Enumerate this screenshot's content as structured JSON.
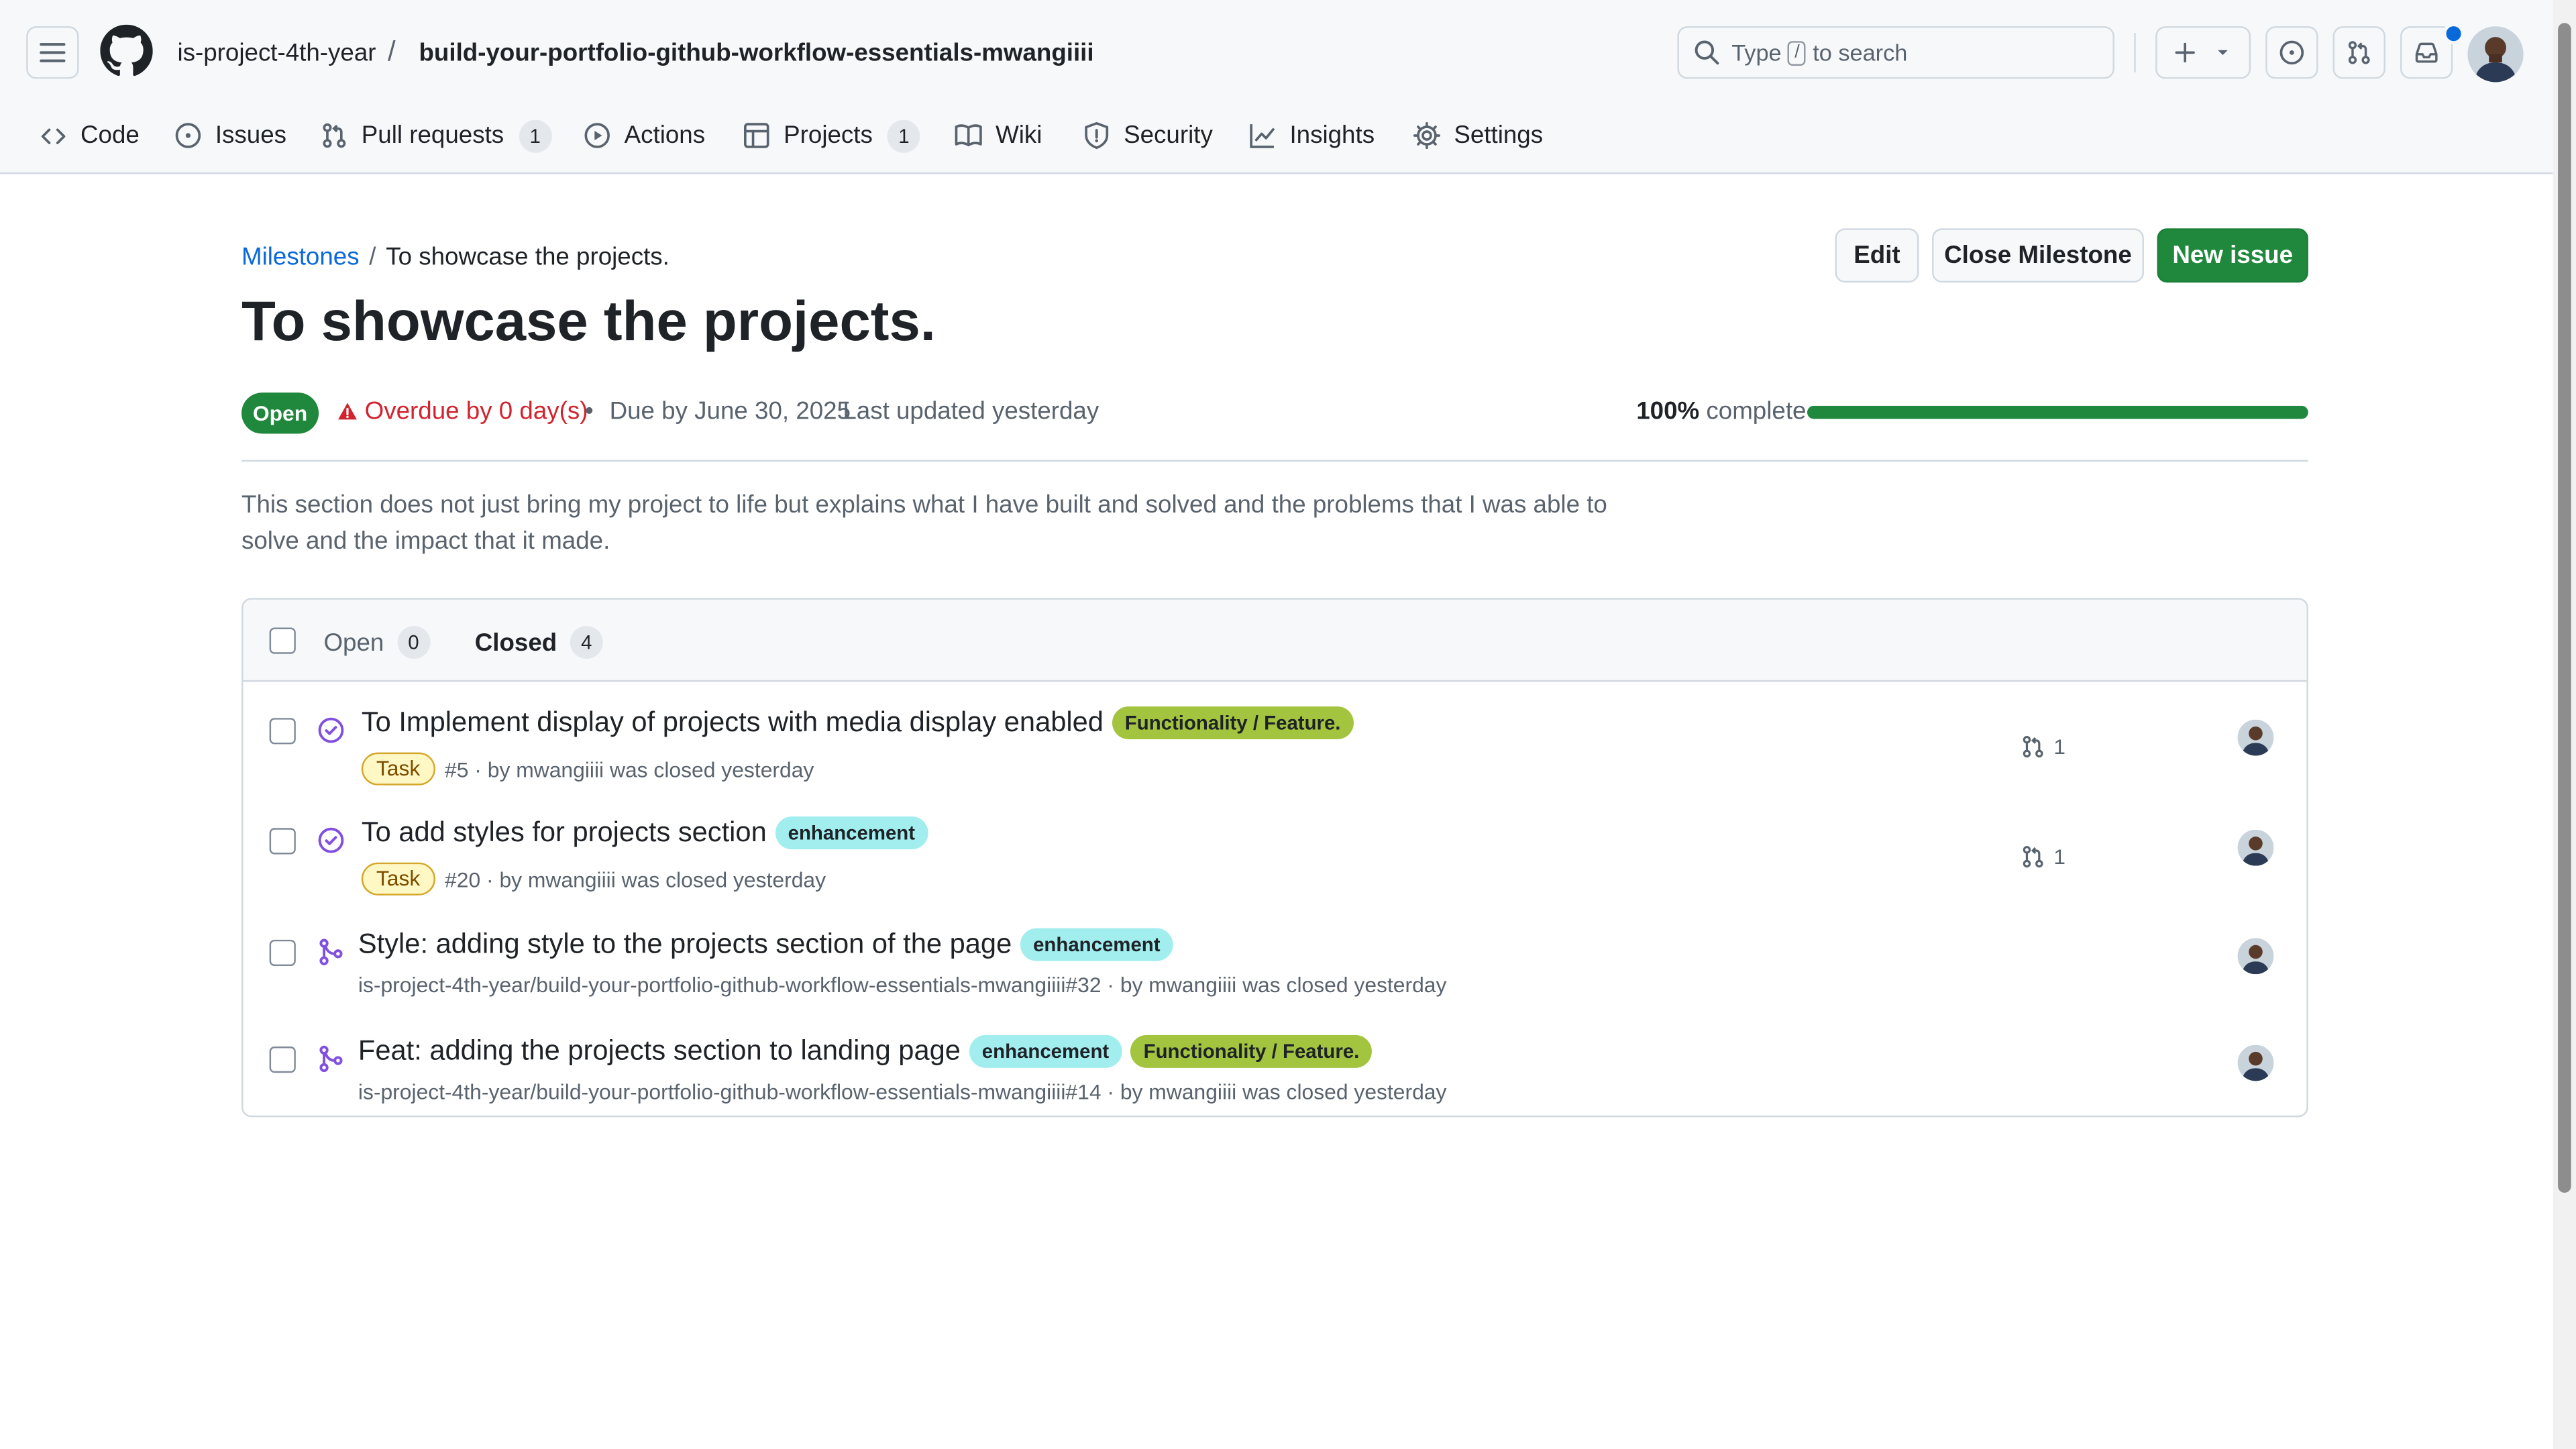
{
  "header": {
    "owner": "is-project-4th-year",
    "separator": "/",
    "repo": "build-your-portfolio-github-workflow-essentials-mwangiiii",
    "search_prefix": "Type",
    "search_key": "/",
    "search_suffix": "to search"
  },
  "tabs": [
    {
      "label": "Code",
      "icon": "code-icon"
    },
    {
      "label": "Issues",
      "icon": "issue-opened-icon"
    },
    {
      "label": "Pull requests",
      "icon": "git-pull-request-icon",
      "count": "1"
    },
    {
      "label": "Actions",
      "icon": "play-icon"
    },
    {
      "label": "Projects",
      "icon": "table-icon",
      "count": "1"
    },
    {
      "label": "Wiki",
      "icon": "book-icon"
    },
    {
      "label": "Security",
      "icon": "shield-icon"
    },
    {
      "label": "Insights",
      "icon": "graph-icon"
    },
    {
      "label": "Settings",
      "icon": "gear-icon"
    }
  ],
  "milestone": {
    "breadcrumb_link": "Milestones",
    "breadcrumb_sep": "/",
    "breadcrumb_current": "To showcase the projects.",
    "title": "To showcase the projects.",
    "state": "Open",
    "overdue": "Overdue by 0 day(s)",
    "bullet": "•",
    "due": "Due by June 30, 2025",
    "updated": "Last updated yesterday",
    "percent": "100%",
    "complete_word": "complete",
    "progress": 1.0,
    "description": "This section does not just bring my project to life but explains what I have built and solved and the problems that I was able to solve and the impact that it made."
  },
  "actions": {
    "edit": "Edit",
    "close": "Close Milestone",
    "new_issue": "New issue"
  },
  "filters": {
    "open_label": "Open",
    "open_count": "0",
    "closed_label": "Closed",
    "closed_count": "4"
  },
  "issues": [
    {
      "title": "To Implement display of projects with media display enabled",
      "labels": [
        "Functionality / Feature."
      ],
      "type": "Task",
      "meta": "#5 · by mwangiiii was closed yesterday",
      "linked_prs": "1"
    },
    {
      "title": "To add styles for projects section",
      "labels": [
        "enhancement"
      ],
      "type": "Task",
      "meta": "#20 · by mwangiiii was closed yesterday",
      "linked_prs": "1"
    },
    {
      "title": "Style: adding style to the projects section of the page",
      "labels": [
        "enhancement"
      ],
      "meta": "is-project-4th-year/build-your-portfolio-github-workflow-essentials-mwangiiii#32 · by mwangiiii was closed yesterday"
    },
    {
      "title": "Feat: adding the projects section to landing page",
      "labels": [
        "enhancement",
        "Functionality / Feature."
      ],
      "meta": "is-project-4th-year/build-your-portfolio-github-workflow-essentials-mwangiiii#14 · by mwangiiii was closed yesterday"
    }
  ],
  "colors": {
    "accent_link": "#0969da",
    "success": "#1f883d",
    "danger": "#d1242f",
    "closed_purple": "#8250df",
    "label_feature": "#a2c43e",
    "label_enhancement": "#a2eeef"
  }
}
